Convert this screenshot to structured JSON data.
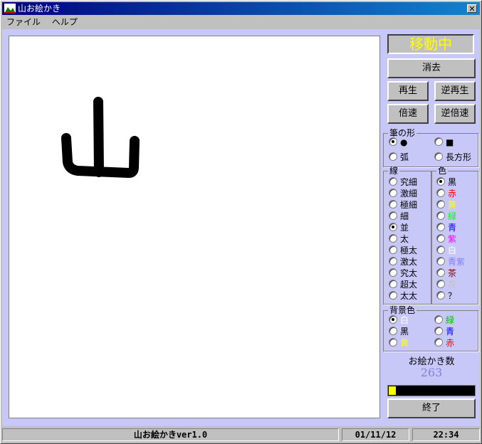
{
  "window": {
    "title": "山お絵かき",
    "close_glyph": "✕"
  },
  "menu": [
    "ファイル",
    "ヘルプ"
  ],
  "status_display": "移動中",
  "buttons": {
    "erase": "消去",
    "play": "再生",
    "reverse_play": "逆再生",
    "double_speed": "倍速",
    "reverse_double": "逆倍速",
    "quit": "終了"
  },
  "brush_shape": {
    "legend": "筆の形",
    "options": [
      {
        "label": "●",
        "selected": true
      },
      {
        "label": "■",
        "selected": false
      },
      {
        "label": "弧",
        "selected": false
      },
      {
        "label": "長方形",
        "selected": false
      }
    ]
  },
  "line": {
    "legend": "線",
    "options": [
      {
        "label": "究細",
        "selected": false
      },
      {
        "label": "激細",
        "selected": false
      },
      {
        "label": "極細",
        "selected": false
      },
      {
        "label": "細",
        "selected": false
      },
      {
        "label": "並",
        "selected": true
      },
      {
        "label": "太",
        "selected": false
      },
      {
        "label": "極太",
        "selected": false
      },
      {
        "label": "激太",
        "selected": false
      },
      {
        "label": "究太",
        "selected": false
      },
      {
        "label": "超太",
        "selected": false
      },
      {
        "label": "太太",
        "selected": false
      }
    ]
  },
  "color": {
    "legend": "色",
    "options": [
      {
        "label": "黒",
        "color": "#000000",
        "selected": true
      },
      {
        "label": "赤",
        "color": "#ff0000",
        "selected": false
      },
      {
        "label": "黄",
        "color": "#ffff00",
        "selected": false
      },
      {
        "label": "緑",
        "color": "#00ff00",
        "selected": false
      },
      {
        "label": "青",
        "color": "#0000ff",
        "selected": false
      },
      {
        "label": "紫",
        "color": "#ff00ff",
        "selected": false
      },
      {
        "label": "白",
        "color": "#ffffff",
        "selected": false
      },
      {
        "label": "青紫",
        "color": "#8080ff",
        "selected": false
      },
      {
        "label": "茶",
        "color": "#800000",
        "selected": false
      },
      {
        "label": "灰",
        "color": "#c0c0c0",
        "selected": false
      },
      {
        "label": "？",
        "color": "#000000",
        "selected": false
      }
    ]
  },
  "background": {
    "legend": "背景色",
    "options": [
      {
        "label": "白",
        "color": "#ffffff",
        "selected": true
      },
      {
        "label": "緑",
        "color": "#00c000",
        "selected": false
      },
      {
        "label": "黒",
        "color": "#000000",
        "selected": false
      },
      {
        "label": "青",
        "color": "#0000ff",
        "selected": false
      },
      {
        "label": "黄",
        "color": "#ffff00",
        "selected": false
      },
      {
        "label": "赤",
        "color": "#ff0000",
        "selected": false
      }
    ]
  },
  "counter": {
    "label": "お絵かき数",
    "value": "263"
  },
  "progress_fraction": 0.08,
  "statusbar": {
    "app": "山お絵かきver1.0",
    "date": "01/11/12",
    "time": "22:34"
  },
  "colors": {
    "status_text": "#ffff00",
    "client_bg": "#c8c8f8",
    "counter_text": "#8080e0",
    "drawing_stroke": "#000000"
  }
}
